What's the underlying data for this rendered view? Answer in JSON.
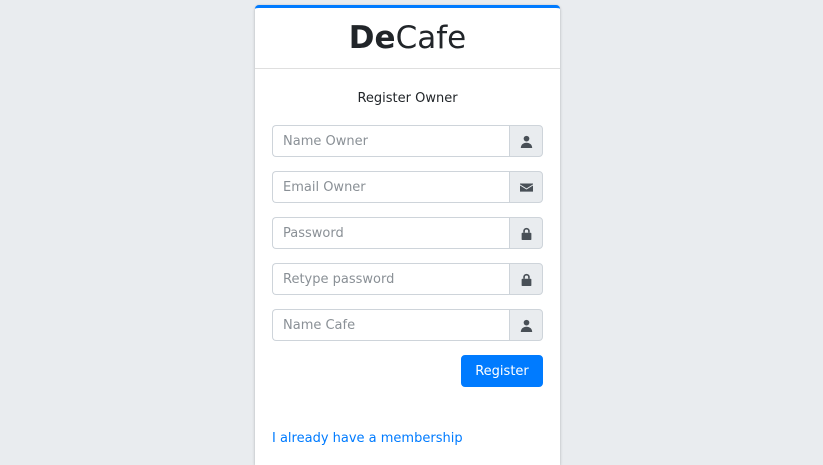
{
  "brand": {
    "bold": "De",
    "regular": "Cafe"
  },
  "form": {
    "message": "Register Owner",
    "fields": [
      {
        "placeholder": "Name Owner",
        "value": "",
        "icon": "user-icon"
      },
      {
        "placeholder": "Email Owner",
        "value": "",
        "icon": "envelope-icon"
      },
      {
        "placeholder": "Password",
        "value": "",
        "icon": "lock-icon"
      },
      {
        "placeholder": "Retype password",
        "value": "",
        "icon": "lock-icon"
      },
      {
        "placeholder": "Name Cafe",
        "value": "",
        "icon": "user-icon"
      }
    ],
    "submit_label": "Register",
    "membership_link": "I already have a membership"
  },
  "colors": {
    "accent": "#007bff",
    "background": "#e9ecef",
    "addon_background": "#e9ecef"
  }
}
